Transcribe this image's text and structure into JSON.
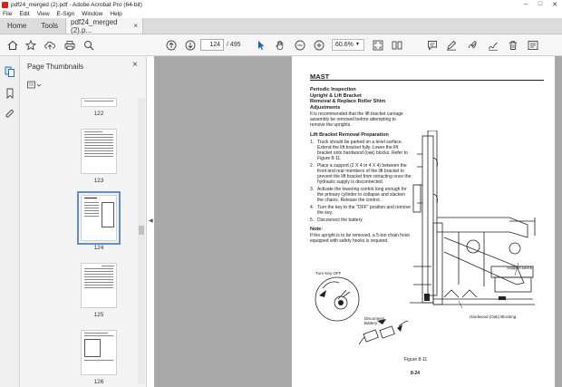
{
  "window": {
    "title": "pdf24_merged (2).pdf - Adobe Acrobat Pro (64-bit)",
    "controls": [
      "–",
      "□",
      "✕"
    ]
  },
  "menu": [
    "File",
    "Edit",
    "View",
    "E-Sign",
    "Window",
    "Help"
  ],
  "tabs": {
    "home": "Home",
    "tools": "Tools",
    "document": "pdf24_merged (2).p...",
    "close": "×"
  },
  "toolbar": {
    "page_current": "124",
    "page_total": "/ 495",
    "zoom": "60.6%"
  },
  "thumbnails": {
    "header": "Page Thumbnails",
    "close": "×",
    "pages": [
      {
        "label": "122"
      },
      {
        "label": "123"
      },
      {
        "label": "124",
        "selected": true
      },
      {
        "label": "125"
      },
      {
        "label": "126"
      }
    ]
  },
  "document": {
    "section": "MAST",
    "heading1": "Periodic Inspection",
    "heading2": "Upright & Lift Bracket",
    "heading3": "Removal & Replace Roller Shim",
    "heading4": "Adjustments",
    "intro": "It is recommended that the lift bracket carriage assembly be removed before attempting to remove the uprights.",
    "procedure_title": "Lift Bracket Removal Preparation",
    "steps": [
      {
        "n": "1.",
        "text": "Truck should be parked on a level surface. Extend the lift bracket fully. Lower the lift bracket onto hardwood (oak) blocks. Refer to Figure 8-11."
      },
      {
        "n": "2.",
        "text": "Place a support (2 X 4 or 4 X 4) between the front and rear members of the lift bracket to prevent the lift bracket from retracting once the hydraulic supply is disconnected."
      },
      {
        "n": "3.",
        "text": "Activate the lowering control long enough for the primary cylinder to collapse and slacken the chains. Release the control."
      },
      {
        "n": "4.",
        "text": "Turn the key to the \"OFF\" position and remove the key."
      },
      {
        "n": "5.",
        "text": "Disconnect the battery."
      }
    ],
    "note_title": "Note:",
    "note_text": "If the upright is to be removed, a 5-ton chain hoist equipped with safety hooks is required.",
    "labels": {
      "support_block": "Support Block",
      "hardwood": "Hardwood (Oak) Blocking",
      "turn_key": "Turn Key OFF",
      "disconnect": "Disconnect Battery"
    },
    "figure_caption": "Figure 8-11",
    "page_number": "8-24"
  }
}
